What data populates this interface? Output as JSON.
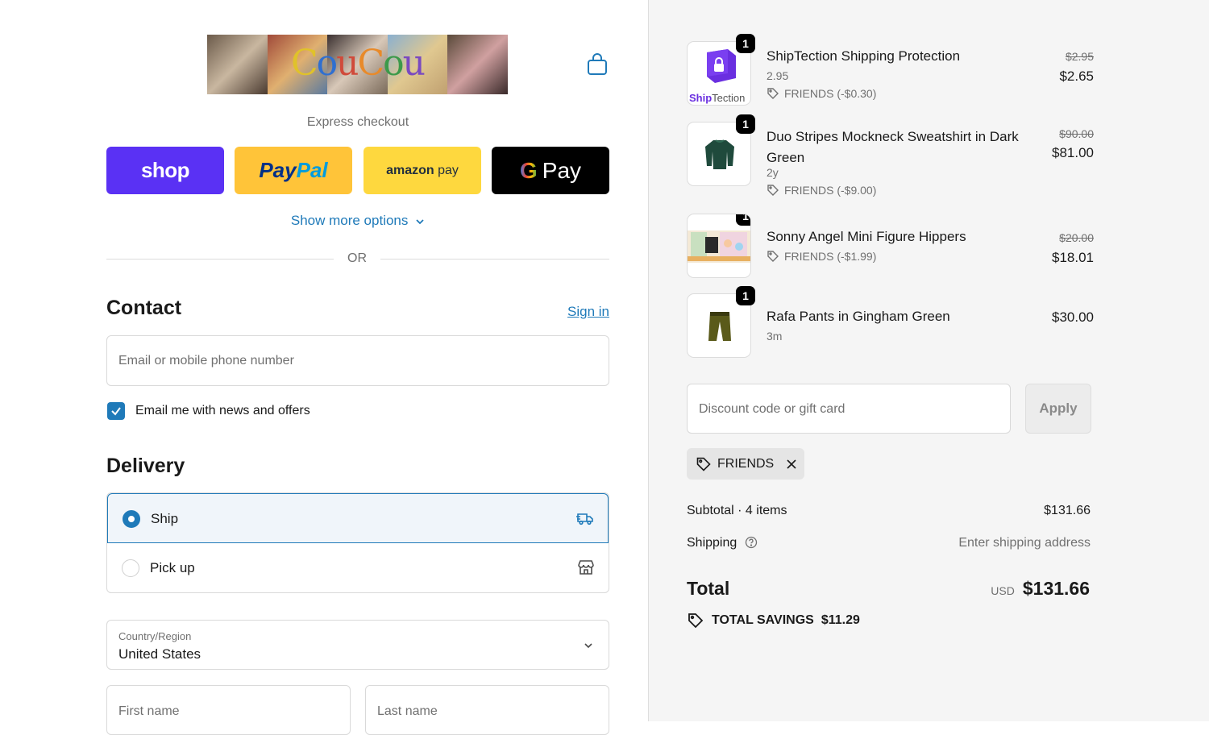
{
  "store": {
    "logo_text": "CouCou"
  },
  "express": {
    "label": "Express checkout",
    "shop_label": "shop",
    "paypal_a": "Pay",
    "paypal_b": "Pal",
    "amazon_a": "amazon",
    "amazon_b": " pay",
    "gpay_g": "G",
    "gpay_label": "Pay",
    "more_options": "Show more options",
    "or": "OR"
  },
  "contact": {
    "title": "Contact",
    "sign_in": "Sign in",
    "email_placeholder": "Email or mobile phone number",
    "news_label": "Email me with news and offers",
    "news_checked": true
  },
  "delivery": {
    "title": "Delivery",
    "options": [
      {
        "label": "Ship",
        "selected": true,
        "icon": "truck-icon"
      },
      {
        "label": "Pick up",
        "selected": false,
        "icon": "store-icon"
      }
    ],
    "country_label": "Country/Region",
    "country_value": "United States",
    "first_name_placeholder": "First name",
    "last_name_placeholder": "Last name"
  },
  "order": {
    "items": [
      {
        "name": "ShipTection Shipping Protection",
        "variant": "2.95",
        "discount": "FRIENDS (-$0.30)",
        "original": "$2.95",
        "price": "$2.65",
        "qty": "1",
        "thumb_text_a": "Ship",
        "thumb_text_b": "Tection"
      },
      {
        "name": "Duo Stripes Mockneck Sweatshirt in Dark Green",
        "variant": "2y",
        "discount": "FRIENDS (-$9.00)",
        "original": "$90.00",
        "price": "$81.00",
        "qty": "1"
      },
      {
        "name": "Sonny Angel Mini Figure Hippers",
        "variant": "",
        "discount": "FRIENDS (-$1.99)",
        "original": "$20.00",
        "price": "$18.01",
        "qty": "1"
      },
      {
        "name": "Rafa Pants in Gingham Green",
        "variant": "3m",
        "discount": "",
        "original": "",
        "price": "$30.00",
        "qty": "1"
      }
    ],
    "discount_placeholder": "Discount code or gift card",
    "apply_label": "Apply",
    "applied_code": "FRIENDS",
    "subtotal_label": "Subtotal · 4 items",
    "subtotal_value": "$131.66",
    "shipping_label": "Shipping",
    "shipping_value": "Enter shipping address",
    "total_label": "Total",
    "currency": "USD",
    "total_value": "$131.66",
    "savings_label": "TOTAL SAVINGS",
    "savings_value": "$11.29"
  },
  "colors": {
    "accent": "#1f7ab9",
    "shop": "#5a31f4",
    "paypal": "#ffc439",
    "amazon": "#fed83e",
    "gpay": "#000000"
  }
}
